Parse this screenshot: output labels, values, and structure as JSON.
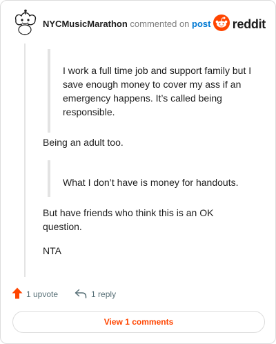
{
  "header": {
    "username": "NYCMusicMarathon",
    "action_text": "commented on",
    "post_link": "post",
    "logo_text": "reddit",
    "avatar_icon": "snoo-avatar-icon",
    "logo_icon": "reddit-snoo-icon"
  },
  "comment": {
    "quote1": "I work a full time job and support family but I save enough money to cover my ass if an emergency happens. It’s called being responsible.",
    "para1": "Being an adult too.",
    "quote2": "What I don’t have is money for handouts.",
    "para2": "But have friends who think this is an OK question.",
    "para3": "NTA"
  },
  "actions": {
    "upvote_label": "1 upvote",
    "reply_label": "1 reply",
    "upvote_icon": "upvote-arrow-icon",
    "reply_icon": "reply-arrow-icon"
  },
  "view_comments_label": "View 1 comments",
  "colors": {
    "accent": "#ff4500",
    "link": "#0079d3",
    "text": "#1c1c1c",
    "muted": "#7c7c7c",
    "quote_bar": "#e3e3e3",
    "border": "#dcdcdc"
  }
}
